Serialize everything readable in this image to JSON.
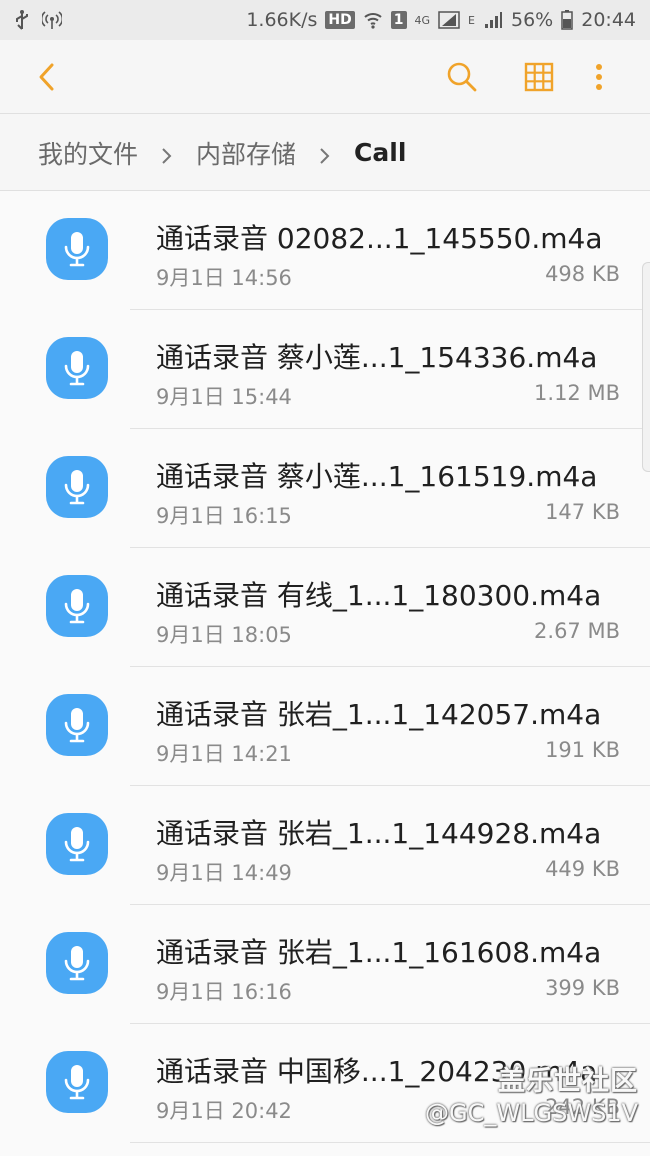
{
  "status_bar": {
    "speed": "1.66K/s",
    "hd_badge": "HD",
    "sim_badge": "1",
    "network_label": "4G",
    "e_label": "E",
    "battery": "56%",
    "time": "20:44"
  },
  "toolbar": {
    "icons": [
      "back-arrow-icon",
      "search-icon",
      "grid-view-icon",
      "more-vert-icon"
    ],
    "accent_color": "#f0a32a"
  },
  "breadcrumb": [
    "我的文件",
    "内部存储",
    "Call"
  ],
  "files": [
    {
      "name": "通话录音 02082...1_145550.m4a",
      "date": "9月1日 14:56",
      "size": "498 KB"
    },
    {
      "name": "通话录音 蔡小莲...1_154336.m4a",
      "date": "9月1日 15:44",
      "size": "1.12 MB"
    },
    {
      "name": "通话录音 蔡小莲...1_161519.m4a",
      "date": "9月1日 16:15",
      "size": "147 KB"
    },
    {
      "name": "通话录音 有线_1...1_180300.m4a",
      "date": "9月1日 18:05",
      "size": "2.67 MB"
    },
    {
      "name": "通话录音 张岩_1...1_142057.m4a",
      "date": "9月1日 14:21",
      "size": "191 KB"
    },
    {
      "name": "通话录音 张岩_1...1_144928.m4a",
      "date": "9月1日 14:49",
      "size": "449 KB"
    },
    {
      "name": "通话录音 张岩_1...1_161608.m4a",
      "date": "9月1日 16:16",
      "size": "399 KB"
    },
    {
      "name": "通话录音 中国移...1_204230.m4a",
      "date": "9月1日 20:42",
      "size": "242 KB"
    }
  ],
  "file_icon": "microphone-icon",
  "file_icon_color": "#4aa8f4",
  "watermark": {
    "line1": "盖乐世社区",
    "line2": "@GC_WLGSWS1V"
  }
}
